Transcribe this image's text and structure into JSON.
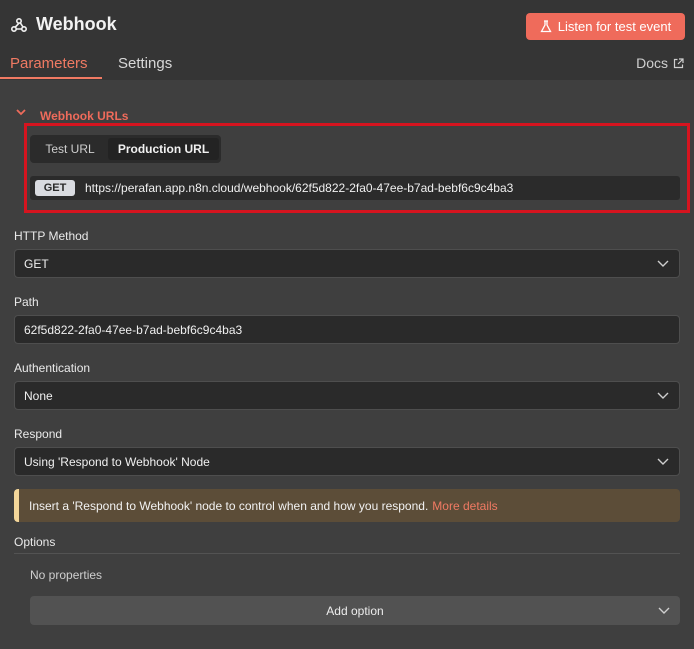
{
  "header": {
    "title": "Webhook",
    "listen_button": "Listen for test event"
  },
  "tabs": {
    "parameters": "Parameters",
    "settings": "Settings",
    "docs": "Docs"
  },
  "webhook_urls": {
    "section_title": "Webhook URLs",
    "tab_test": "Test URL",
    "tab_production": "Production URL",
    "selected_tab": "Production URL",
    "method_badge": "GET",
    "url": "https://perafan.app.n8n.cloud/webhook/62f5d822-2fa0-47ee-b7ad-bebf6c9c4ba3"
  },
  "form": {
    "http_method": {
      "label": "HTTP Method",
      "value": "GET"
    },
    "path": {
      "label": "Path",
      "value": "62f5d822-2fa0-47ee-b7ad-bebf6c9c4ba3"
    },
    "authentication": {
      "label": "Authentication",
      "value": "None"
    },
    "respond": {
      "label": "Respond",
      "value": "Using 'Respond to Webhook' Node"
    }
  },
  "notice": {
    "text": "Insert a 'Respond to Webhook' node to control when and how you respond.",
    "link": "More details"
  },
  "options": {
    "label": "Options",
    "empty_text": "No properties",
    "add_button": "Add option"
  },
  "colors": {
    "accent": "#ef6b5b",
    "highlight_border": "#d6141f",
    "notice_bg": "#5c4d38",
    "notice_border": "#f3d69a"
  },
  "icons": {
    "title": "webhook-icon",
    "listen": "flask-icon",
    "docs": "external-link-icon",
    "section_toggle": "chevron-down-icon",
    "dropdown": "chevron-down-icon"
  }
}
